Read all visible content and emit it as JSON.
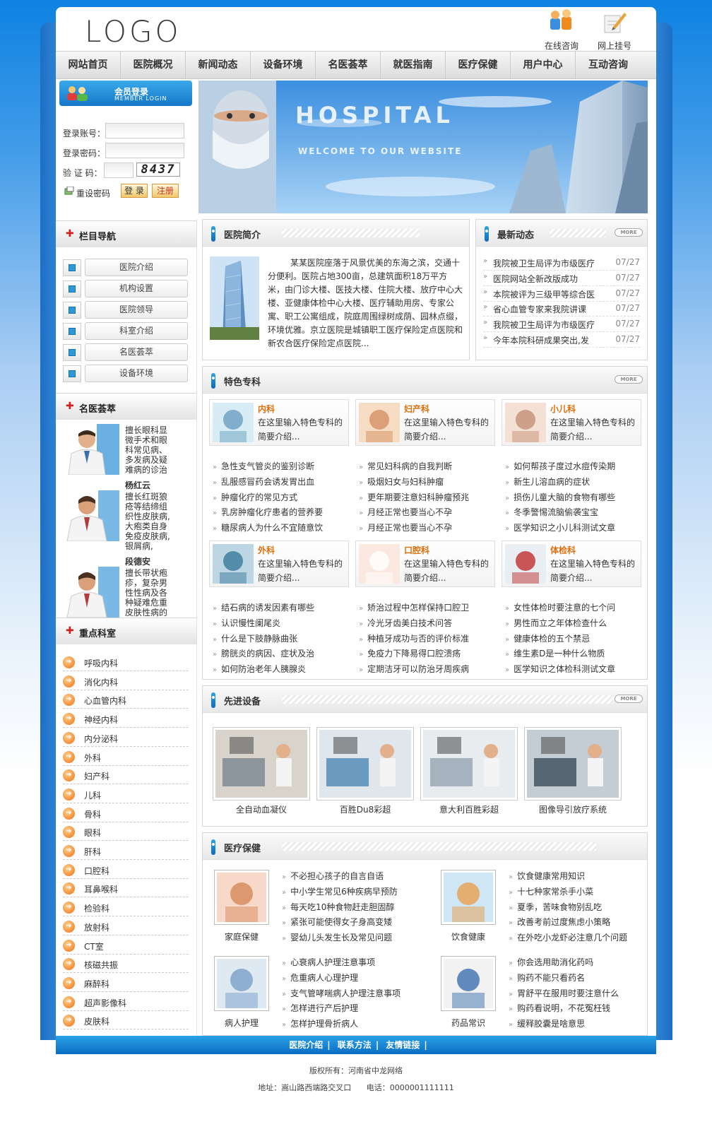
{
  "header": {
    "logo": "LOGO",
    "consult": "在线咨询",
    "register": "网上挂号"
  },
  "nav": [
    "网站首页",
    "医院概况",
    "新闻动态",
    "设备环境",
    "名医荟萃",
    "就医指南",
    "医疗保健",
    "用户中心",
    "互动咨询"
  ],
  "login": {
    "title": "会员登录",
    "subtitle": "MEMBER LOGIN",
    "account_label": "登录账号：",
    "password_label": "登录密码：",
    "captcha_label": "验 证 码：",
    "captcha": "8437",
    "reset": "重设密码",
    "login_btn": "登 录",
    "register_btn": "注册"
  },
  "banner": {
    "title": "HOSPITAL",
    "subtitle": "WELCOME TO OUR WEBSITE"
  },
  "column_nav": {
    "title": "栏目导航",
    "items": [
      "医院介绍",
      "机构设置",
      "医院领导",
      "科室介绍",
      "名医荟萃",
      "设备环境"
    ]
  },
  "doctors": {
    "title": "名医荟萃",
    "list": [
      {
        "desc": "擅长眼科显微手术和眼科常见病、多发病及疑难病的诊治",
        "name": "杨红云"
      },
      {
        "desc": "擅长红斑狼疮等结缔组织性皮肤病,大疱类自身免疫皮肤病,银屑病,",
        "name": "段德安"
      },
      {
        "desc": "擅长带状疱疹，复杂男性性病及各种疑难危重皮肤性病的",
        "name": ""
      }
    ]
  },
  "departments": {
    "title": "重点科室",
    "items": [
      "呼吸内科",
      "消化内科",
      "心血管内科",
      "神经内科",
      "内分泌科",
      "外科",
      "妇产科",
      "儿科",
      "骨科",
      "眼科",
      "肝科",
      "口腔科",
      "耳鼻喉科",
      "检验科",
      "放射科",
      "CT室",
      "核磁共振",
      "麻醉科",
      "超声影像科",
      "皮肤科"
    ]
  },
  "intro": {
    "title": "医院简介",
    "text": "某某医院座落于风景优美的东海之滨，交通十分便利。医院占地300亩，总建筑面积18万平方米，由门诊大楼、医技大楼、住院大楼、放疗中心大楼、亚健康体检中心大楼、医疗辅助用房、专家公寓、职工公寓组成，院庭周围绿树成荫、园林点缀，环境优雅。京立医院是城镇职工医疗保险定点医院和新农合医疗保险定点医院..."
  },
  "news": {
    "title": "最新动态",
    "more": "MORE",
    "items": [
      {
        "text": "我院被卫生局评为市级医疗",
        "date": "07/27"
      },
      {
        "text": "医院网站全新改版成功",
        "date": "07/27"
      },
      {
        "text": "本院被评为三级甲等综合医",
        "date": "07/27"
      },
      {
        "text": "省心血管专家来我院讲课",
        "date": "07/27"
      },
      {
        "text": "我院被卫生局评为市级医疗",
        "date": "07/27"
      },
      {
        "text": "今年本院科研成果突出,发",
        "date": "07/27"
      }
    ]
  },
  "specialty": {
    "title": "特色专科",
    "more": "MORE",
    "desc": "在这里输入特色专科的简要介绍...",
    "groups": [
      {
        "depts": [
          "内科",
          "妇产科",
          "小儿科"
        ],
        "articles": [
          [
            "急性支气管炎的鉴别诊断",
            "乱服感冒药会诱发胃出血",
            "肿瘤化疗的常见方式",
            "乳房肿瘤化疗患者的营养要",
            "糖尿病人为什么不宜随意饮"
          ],
          [
            "常见妇科病的自我判断",
            "吸烟妇女与妇科肿瘤",
            "更年期要注意妇科肿瘤预兆",
            "月经正常也要当心不孕",
            "月经正常也要当心不孕"
          ],
          [
            "如何帮孩子度过水痘传染期",
            "新生儿溶血病的症状",
            "损伤儿童大脑的食物有哪些",
            "冬季警惕流脑偷袭宝宝",
            "医学知识之小儿科测试文章"
          ]
        ]
      },
      {
        "depts": [
          "外科",
          "口腔科",
          "体检科"
        ],
        "articles": [
          [
            "结石病的诱发因素有哪些",
            "认识慢性阑尾炎",
            "什么是下肢静脉曲张",
            "膀胱炎的病因、症状及治",
            "如何防治老年人胰腺炎"
          ],
          [
            "矫治过程中怎样保持口腔卫",
            "冷光牙齿美白技术问答",
            "种植牙成功与否的评价标准",
            "免疫力下降易得口腔溃疡",
            "定期洁牙可以防治牙周疾病"
          ],
          [
            "女性体检时要注意的七个问",
            "男性而立之年体检查什么",
            "健康体检的五个禁忌",
            "维生素D是一种什么物质",
            "医学知识之体检科测试文章"
          ]
        ]
      }
    ]
  },
  "equipment": {
    "title": "先进设备",
    "more": "MORE",
    "items": [
      "全自动血凝仪",
      "百胜Du8彩超",
      "意大利百胜彩超",
      "图像导引放疗系统"
    ]
  },
  "healthcare": {
    "title": "医疗保健",
    "sections": [
      {
        "caption": "家庭保健",
        "items": [
          "不必担心孩子的自言自语",
          "中小学生常见6种疾病早预防",
          "每天吃10种食物赶走胆固醇",
          "紧张可能使得女子身高变矮",
          "婴幼儿头发生长及常见问题"
        ]
      },
      {
        "caption": "饮食健康",
        "items": [
          "饮食健康常用知识",
          "十七种家常杀手小菜",
          "夏季，苦味食物别乱吃",
          "改善考前过度焦虑小策略",
          "在外吃小龙虾必注意几个问题"
        ]
      },
      {
        "caption": "病人护理",
        "items": [
          "心衰病人护理注意事项",
          "危重病人心理护理",
          "支气管哮喘病人护理注意事项",
          "怎样进行产后护理",
          "怎样护理骨折病人"
        ]
      },
      {
        "caption": "药品常识",
        "items": [
          "你会选用助消化药吗",
          "购药不能只看药名",
          "胃舒平在服用时要注意什么",
          "购药看说明，不花冤枉钱",
          "缓释胶囊是啥意思"
        ]
      }
    ]
  },
  "footer": {
    "links": [
      "医院介绍",
      "联系方法",
      "友情链接"
    ],
    "copyright": "版权所有：河南省中龙网络",
    "address": "地址：嵩山路西端路交叉口",
    "phone": "电话：0000001111111"
  }
}
